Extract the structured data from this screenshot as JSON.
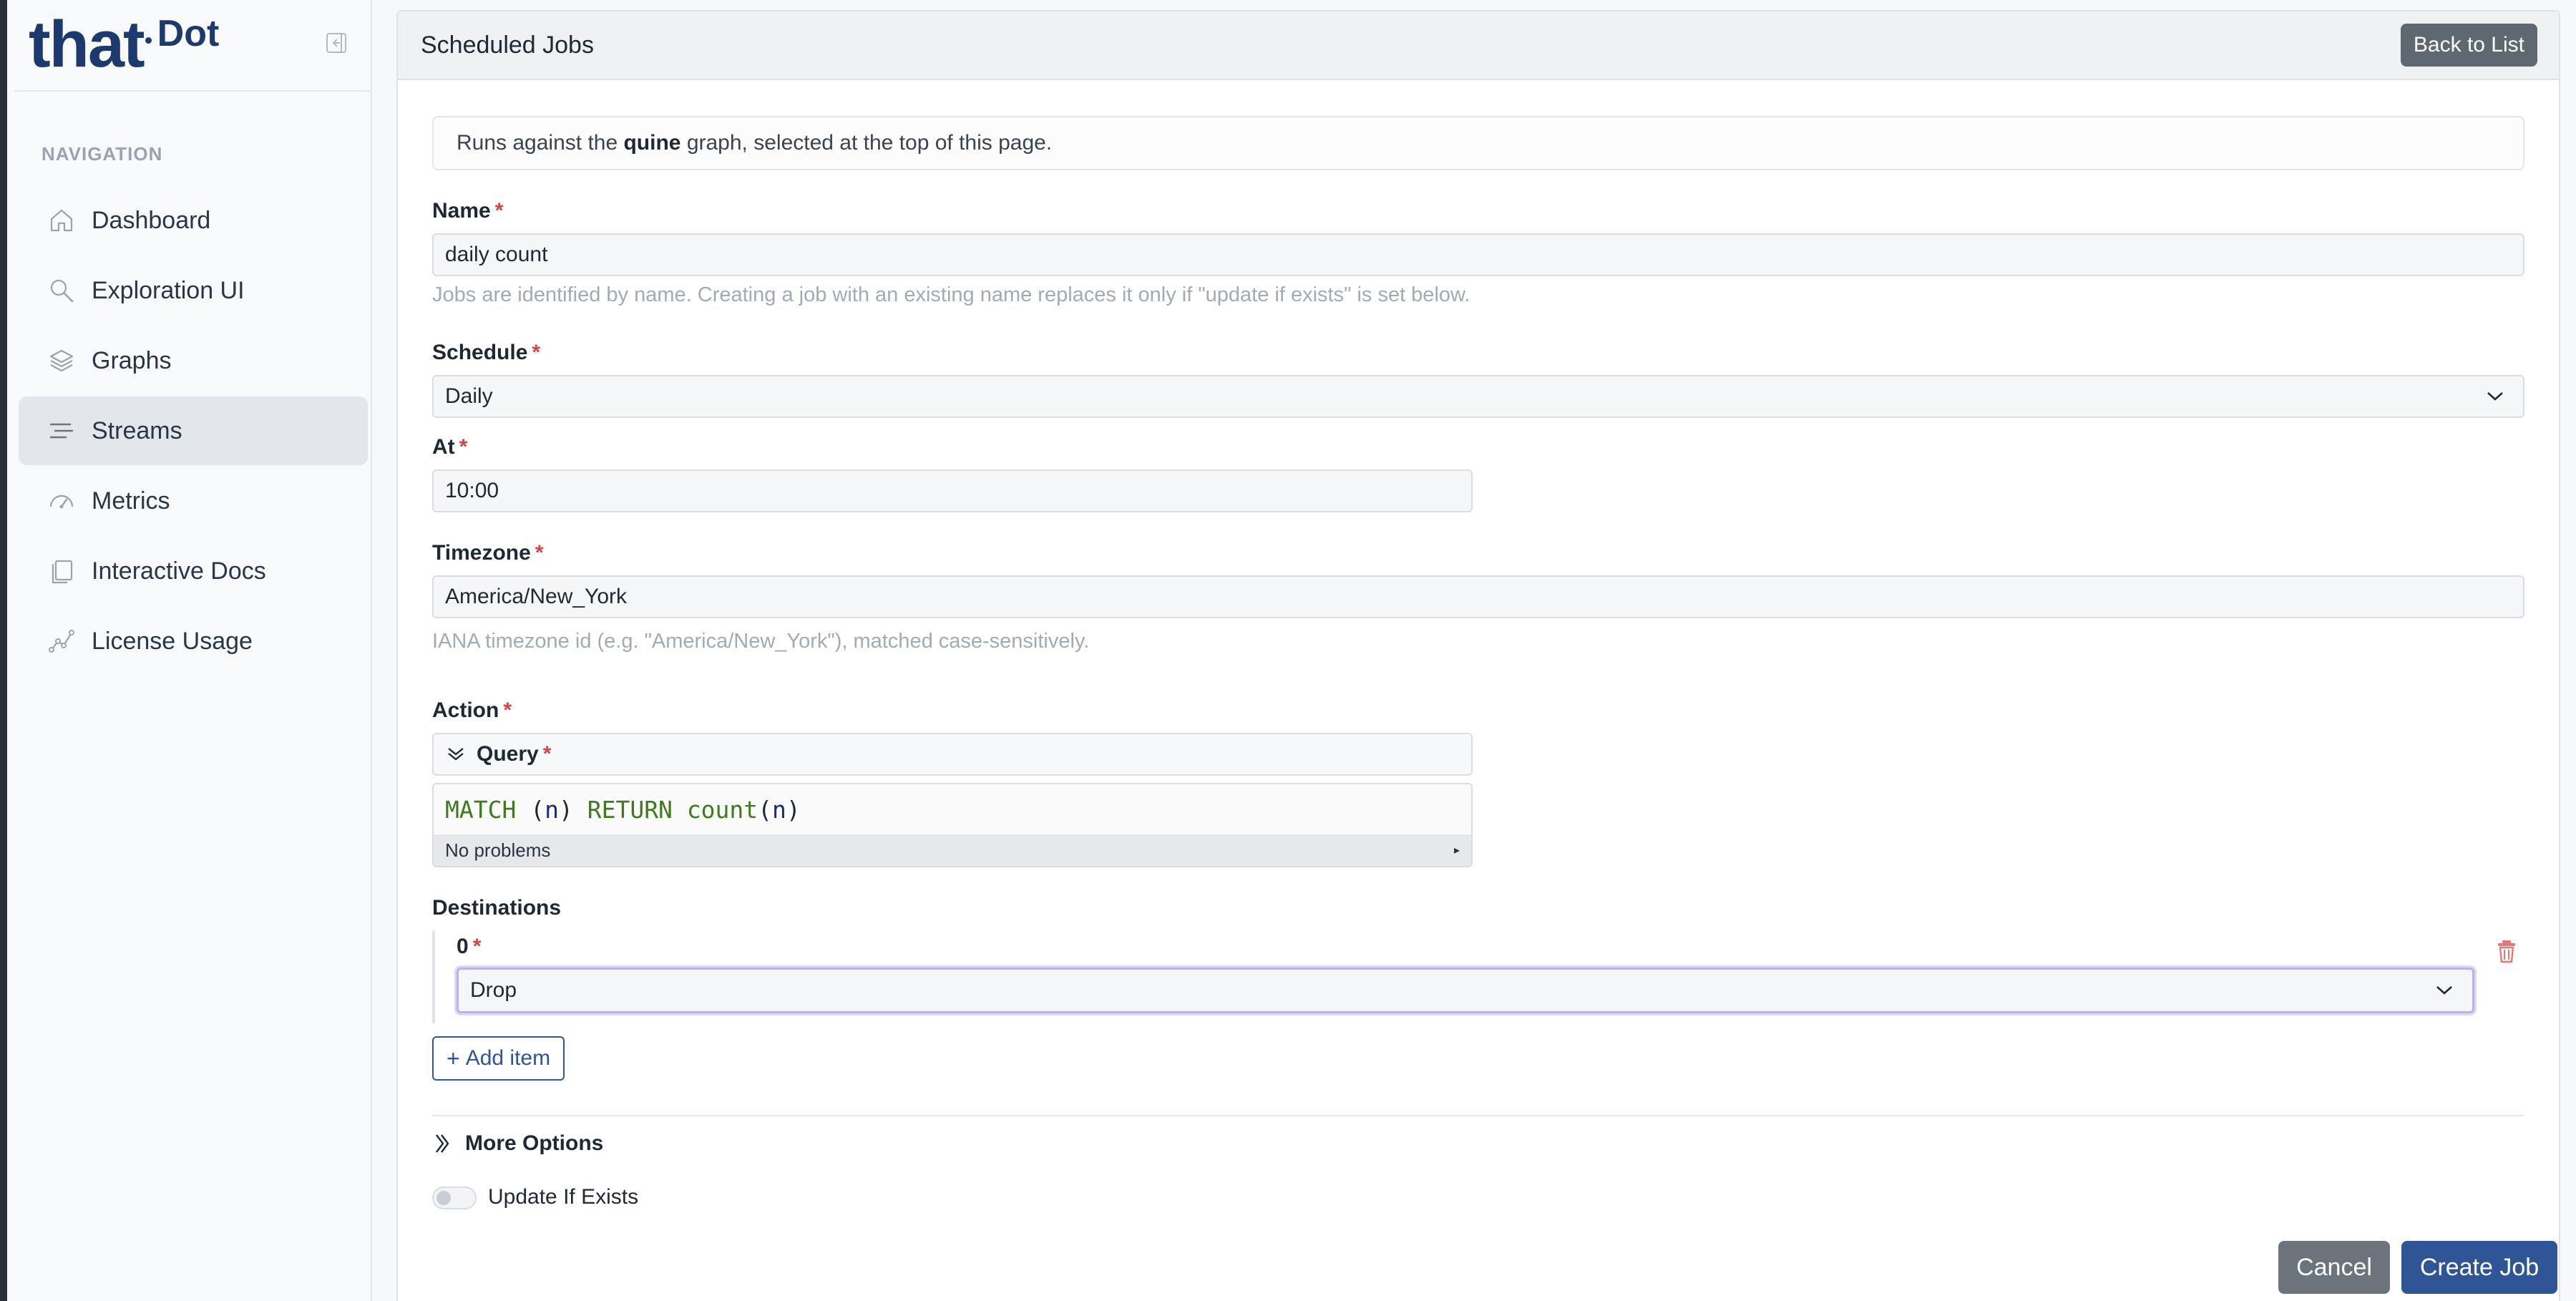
{
  "brand": {
    "that": "that",
    "dot": "Dot"
  },
  "sidebar": {
    "heading": "NAVIGATION",
    "items": [
      {
        "label": "Dashboard",
        "icon": "home-icon"
      },
      {
        "label": "Exploration UI",
        "icon": "search-icon"
      },
      {
        "label": "Graphs",
        "icon": "layers-icon"
      },
      {
        "label": "Streams",
        "icon": "streams-icon",
        "active": true
      },
      {
        "label": "Metrics",
        "icon": "gauge-icon"
      },
      {
        "label": "Interactive Docs",
        "icon": "docs-icon"
      },
      {
        "label": "License Usage",
        "icon": "chart-line-icon"
      }
    ]
  },
  "header": {
    "title": "Scheduled Jobs",
    "back_label": "Back to List"
  },
  "info": {
    "prefix": "Runs against the ",
    "graph": "quine",
    "suffix": " graph, selected at the top of this page."
  },
  "form": {
    "name": {
      "label": "Name",
      "value": "daily count",
      "help": "Jobs are identified by name. Creating a job with an existing name replaces it only if \"update if exists\" is set below."
    },
    "schedule": {
      "label": "Schedule",
      "value": "Daily"
    },
    "at": {
      "label": "At",
      "value": "10:00"
    },
    "timezone": {
      "label": "Timezone",
      "value": "America/New_York",
      "help": "IANA timezone id (e.g. \"America/New_York\"), matched case-sensitively."
    },
    "action": {
      "label": "Action",
      "query_label": "Query",
      "code": {
        "match": "MATCH",
        "lp1": "(",
        "n1": "n",
        "rp1": ")",
        "ret": "RETURN",
        "count": "count",
        "lp2": "(",
        "n2": "n",
        "rp2": ")"
      },
      "problems": "No problems"
    },
    "destinations": {
      "label": "Destinations",
      "index": "0",
      "value": "Drop",
      "add_label": "Add item"
    },
    "more_options": "More Options",
    "update_if_exists": {
      "label": "Update If Exists",
      "value": false
    }
  },
  "actions": {
    "cancel": "Cancel",
    "create": "Create Job"
  },
  "colors": {
    "primary": "#2f5597",
    "required": "#d64545",
    "brand": "#1d3a6e"
  }
}
